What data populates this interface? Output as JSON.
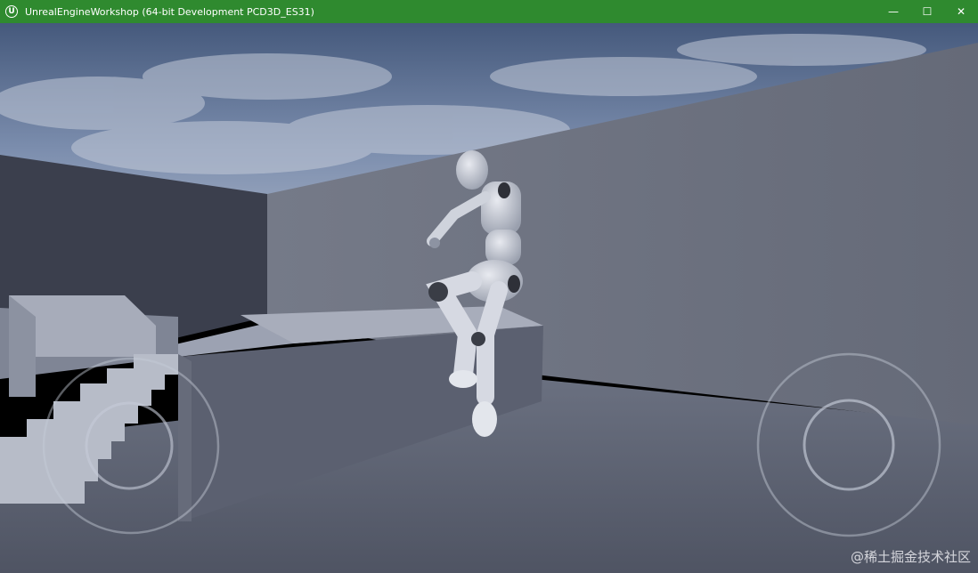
{
  "window": {
    "title": "UnrealEngineWorkshop (64-bit Development PCD3D_ES31)",
    "logo_text": "U",
    "controls": {
      "minimize": "—",
      "maximize": "☐",
      "close": "✕"
    }
  },
  "viewport": {
    "scene": "third-person-template-level",
    "left_joystick": "movement-joystick",
    "right_joystick": "camera-joystick"
  },
  "watermark": {
    "text": "@稀土掘金技术社区"
  },
  "colors": {
    "titlebar": "#2f8a2f",
    "sky": "#5e7498",
    "floor": "#5c6272",
    "wall": "#6b707e"
  }
}
